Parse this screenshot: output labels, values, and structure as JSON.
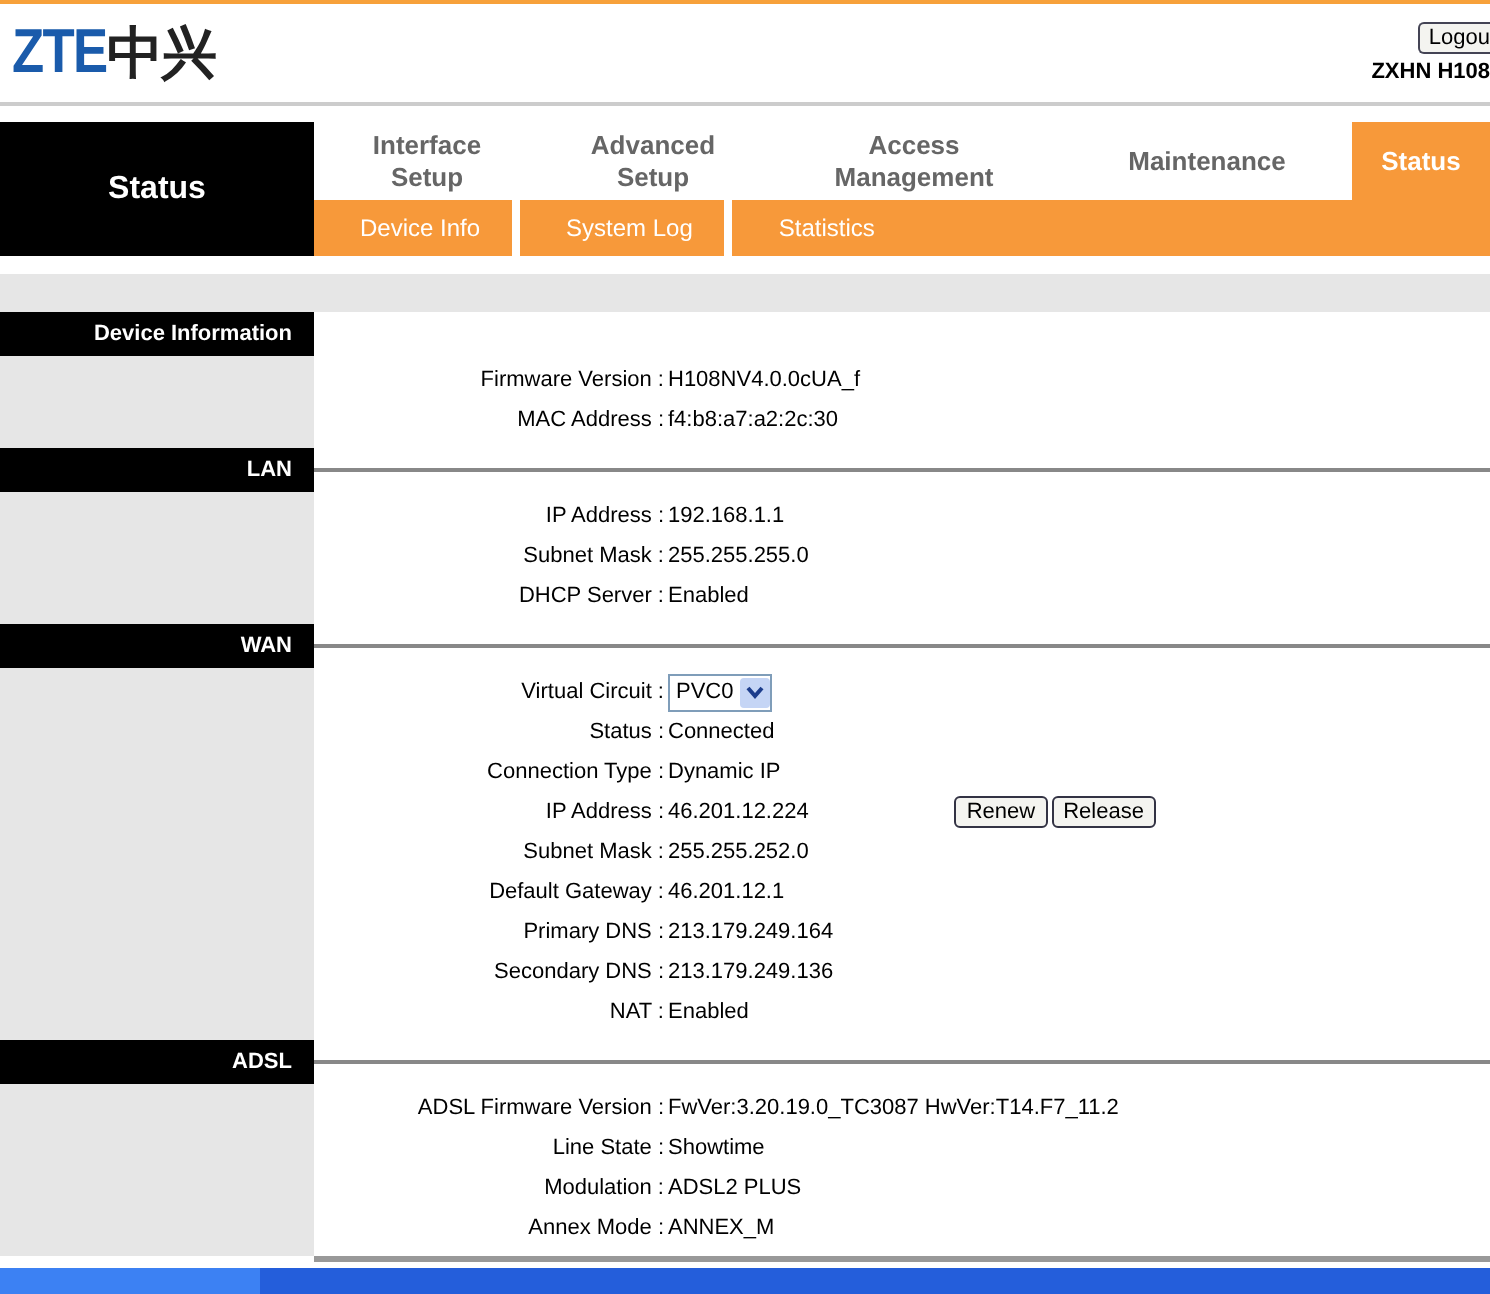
{
  "header": {
    "logo_latin": "ZTE",
    "logo_cjk": "中兴",
    "logout_button": "Logou",
    "model": "ZXHN H108"
  },
  "sidebar_title": "Status",
  "tabs": [
    {
      "label": "Interface\nSetup",
      "selected": false
    },
    {
      "label": "Advanced\nSetup",
      "selected": false
    },
    {
      "label": "Access\nManagement",
      "selected": false
    },
    {
      "label": "Maintenance",
      "selected": false
    },
    {
      "label": "Status",
      "selected": true
    }
  ],
  "subtabs": [
    {
      "label": "Device Info",
      "selected": false
    },
    {
      "label": "System Log",
      "selected": false
    },
    {
      "label": "Statistics",
      "selected": false
    }
  ],
  "sections": [
    {
      "title": "Device Information",
      "rule": false,
      "rows": [
        {
          "kind": "text",
          "label": "Firmware Version :",
          "value": "H108NV4.0.0cUA_f"
        },
        {
          "kind": "text",
          "label": "MAC Address :",
          "value": "f4:b8:a7:a2:2c:30"
        }
      ]
    },
    {
      "title": "LAN",
      "rule": true,
      "rows": [
        {
          "kind": "text",
          "label": "IP Address :",
          "value": "192.168.1.1"
        },
        {
          "kind": "text",
          "label": "Subnet Mask :",
          "value": "255.255.255.0"
        },
        {
          "kind": "text",
          "label": "DHCP Server :",
          "value": "Enabled"
        }
      ]
    },
    {
      "title": "WAN",
      "rule": true,
      "rows": [
        {
          "kind": "select",
          "label": "Virtual Circuit :",
          "value": "PVC0"
        },
        {
          "kind": "text",
          "label": "Status :",
          "value": "Connected"
        },
        {
          "kind": "text",
          "label": "Connection Type :",
          "value": "Dynamic IP"
        },
        {
          "kind": "text",
          "label": "IP Address :",
          "value": "46.201.12.224",
          "buttons": [
            "Renew",
            "Release"
          ]
        },
        {
          "kind": "text",
          "label": "Subnet Mask :",
          "value": "255.255.252.0"
        },
        {
          "kind": "text",
          "label": "Default Gateway :",
          "value": "46.201.12.1"
        },
        {
          "kind": "text",
          "label": "Primary DNS :",
          "value": "213.179.249.164"
        },
        {
          "kind": "text",
          "label": "Secondary DNS :",
          "value": "213.179.249.136"
        },
        {
          "kind": "text",
          "label": "NAT :",
          "value": "Enabled"
        }
      ]
    },
    {
      "title": "ADSL",
      "rule": true,
      "rows": [
        {
          "kind": "text",
          "label": "ADSL Firmware Version :",
          "value": "FwVer:3.20.19.0_TC3087 HwVer:T14.F7_11.2"
        },
        {
          "kind": "text",
          "label": "Line State :",
          "value": "Showtime"
        },
        {
          "kind": "text",
          "label": "Modulation :",
          "value": "ADSL2 PLUS"
        },
        {
          "kind": "text",
          "label": "Annex Mode :",
          "value": "ANNEX_M"
        }
      ]
    }
  ]
}
